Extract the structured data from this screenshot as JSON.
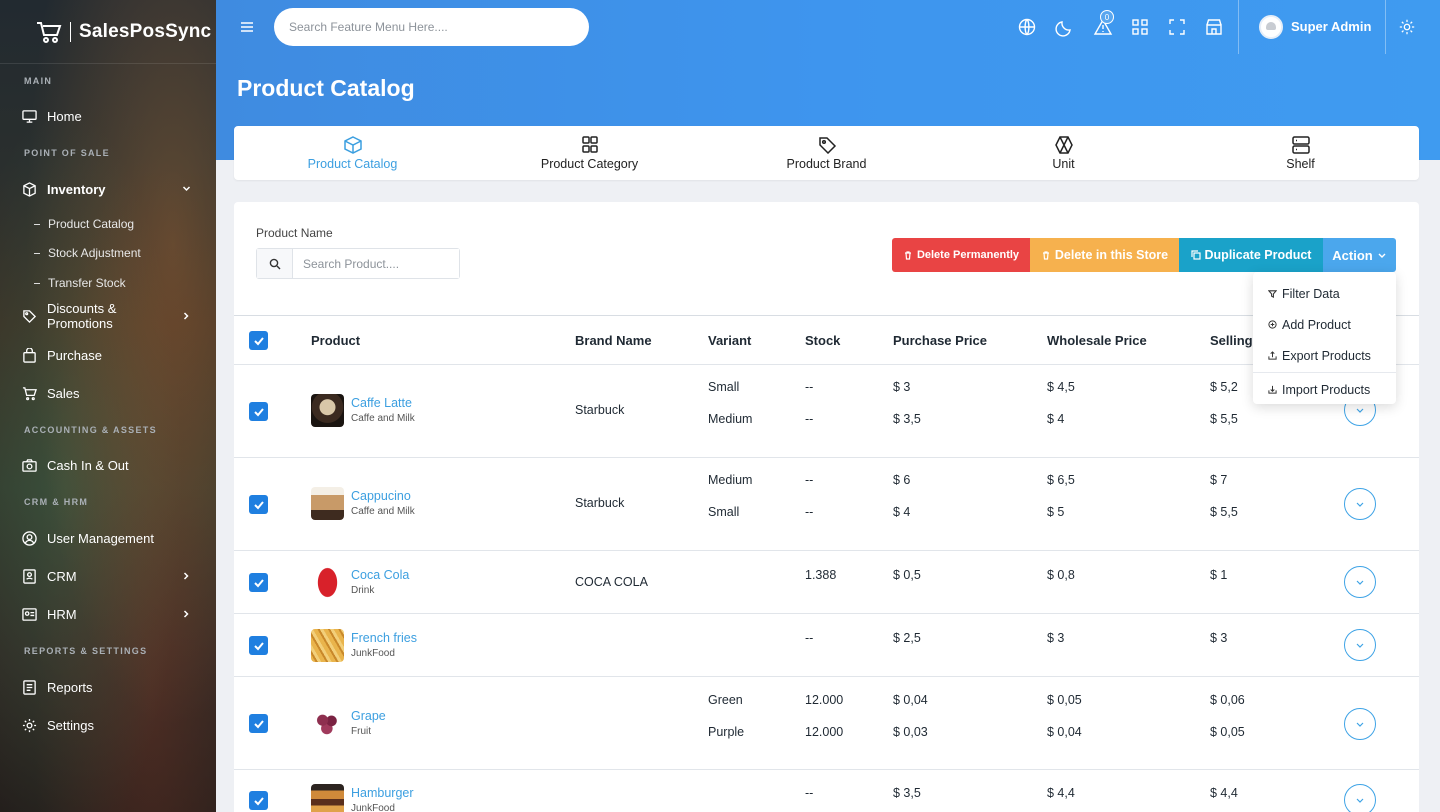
{
  "app": {
    "brand": "SalesPosSync"
  },
  "sidebar": {
    "sections": {
      "main": "MAIN",
      "pos": "POINT OF SALE",
      "accounting": "ACCOUNTING & ASSETS",
      "crm": "CRM & HRM",
      "reports": "REPORTS & SETTINGS"
    },
    "items": {
      "home": "Home",
      "inventory": "Inventory",
      "product_catalog": "Product Catalog",
      "stock_adjustment": "Stock Adjustment",
      "transfer_stock": "Transfer Stock",
      "discounts": "Discounts & Promotions",
      "purchase": "Purchase",
      "sales": "Sales",
      "cash": "Cash In & Out",
      "user_management": "User Management",
      "crm": "CRM",
      "hrm": "HRM",
      "reports": "Reports",
      "settings": "Settings"
    }
  },
  "header": {
    "search_placeholder": "Search Feature Menu Here....",
    "notification_count": "0",
    "user_name": "Super Admin",
    "page_title": "Product Catalog"
  },
  "tabs": [
    "Product Catalog",
    "Product Category",
    "Product Brand",
    "Unit",
    "Shelf"
  ],
  "filter": {
    "label": "Product Name",
    "placeholder": "Search Product...."
  },
  "actions": {
    "delete_permanently": "Delete Permanently",
    "delete_store": "Delete in this Store",
    "duplicate": "Duplicate Product",
    "action": "Action"
  },
  "action_menu": [
    "Filter Data",
    "Add Product",
    "Export Products",
    "Import Products"
  ],
  "table": {
    "columns": {
      "product": "Product",
      "brand": "Brand Name",
      "variant": "Variant",
      "stock": "Stock",
      "purchase": "Purchase Price",
      "wholesale": "Wholesale Price",
      "selling": "Selling"
    },
    "rows": [
      {
        "name": "Caffe Latte",
        "category": "Caffe and Milk",
        "brand": "Starbuck",
        "variants": [
          {
            "variant": "Small",
            "stock": "--",
            "purchase": "$ 3",
            "wholesale": "$ 4,5",
            "selling": "$ 5,2"
          },
          {
            "variant": "Medium",
            "stock": "--",
            "purchase": "$ 3,5",
            "wholesale": "$ 4",
            "selling": "$ 5,5"
          }
        ]
      },
      {
        "name": "Cappucino",
        "category": "Caffe and Milk",
        "brand": "Starbuck",
        "variants": [
          {
            "variant": "Medium",
            "stock": "--",
            "purchase": "$ 6",
            "wholesale": "$ 6,5",
            "selling": "$ 7"
          },
          {
            "variant": "Small",
            "stock": "--",
            "purchase": "$ 4",
            "wholesale": "$ 5",
            "selling": "$ 5,5"
          }
        ]
      },
      {
        "name": "Coca Cola",
        "category": "Drink",
        "brand": "COCA COLA",
        "variants": [
          {
            "variant": "",
            "stock": "1.388",
            "purchase": "$ 0,5",
            "wholesale": "$ 0,8",
            "selling": "$ 1"
          }
        ]
      },
      {
        "name": "French fries",
        "category": "JunkFood",
        "brand": "",
        "variants": [
          {
            "variant": "",
            "stock": "--",
            "purchase": "$ 2,5",
            "wholesale": "$ 3",
            "selling": "$ 3"
          }
        ]
      },
      {
        "name": "Grape",
        "category": "Fruit",
        "brand": "",
        "variants": [
          {
            "variant": "Green",
            "stock": "12.000",
            "purchase": "$ 0,04",
            "wholesale": "$ 0,05",
            "selling": "$ 0,06"
          },
          {
            "variant": "Purple",
            "stock": "12.000",
            "purchase": "$ 0,03",
            "wholesale": "$ 0,04",
            "selling": "$ 0,05"
          }
        ]
      },
      {
        "name": "Hamburger",
        "category": "JunkFood",
        "brand": "",
        "variants": [
          {
            "variant": "",
            "stock": "--",
            "purchase": "$ 3,5",
            "wholesale": "$ 4,4",
            "selling": "$ 4,4"
          }
        ]
      }
    ]
  },
  "colors": {
    "header": "#3e95ee",
    "accent": "#3c9fe0",
    "danger": "#e94444",
    "warning": "#f6b14e",
    "info": "#1aa2c9",
    "checkbox": "#1f7fe0"
  }
}
